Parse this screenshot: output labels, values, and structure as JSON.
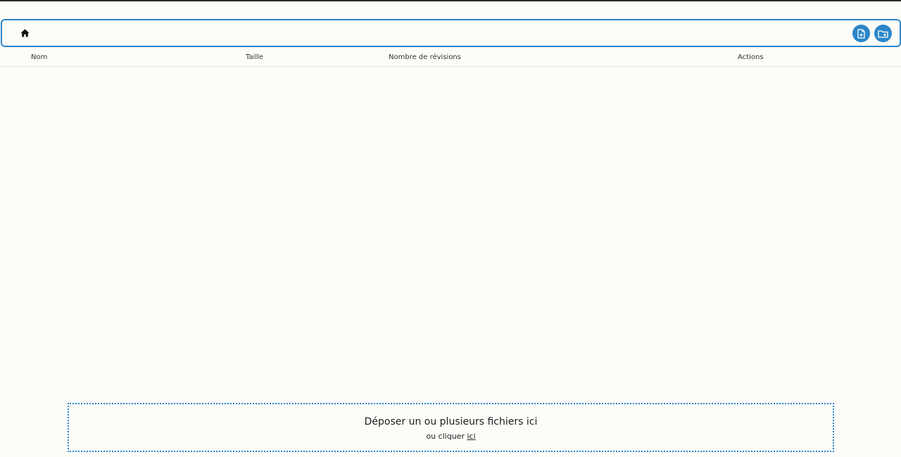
{
  "toolbar": {
    "home_icon": "home-icon",
    "new_file_icon": "file-add-icon",
    "new_folder_icon": "folder-add-icon",
    "accent_color": "#2a86c9"
  },
  "table": {
    "columns": [
      "Nom",
      "Taille",
      "Nombre de révisions",
      "Actions"
    ],
    "rows": []
  },
  "dropzone": {
    "title": "Déposer un ou plusieurs fichiers ici",
    "sub_prefix": "ou cliquer ",
    "link_text": "ici"
  }
}
